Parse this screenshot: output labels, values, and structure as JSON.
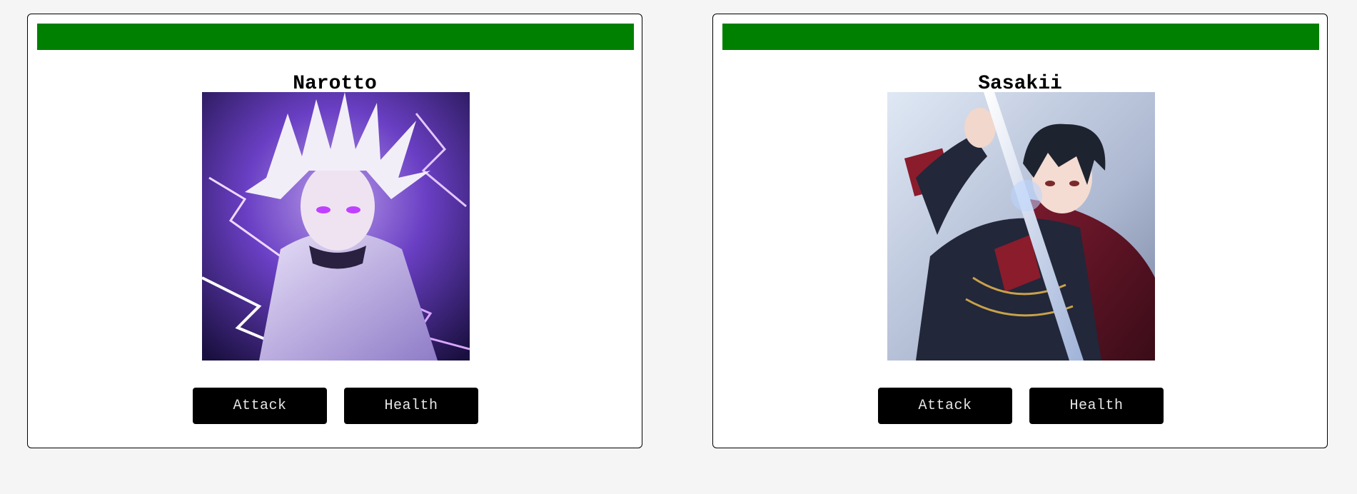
{
  "colors": {
    "health_bar": "#008000",
    "button_bg": "#000000",
    "button_text": "#e6e6e6"
  },
  "cards": [
    {
      "name": "Narotto",
      "health_percent": 100,
      "portrait": "white-haired anime character with purple lightning",
      "buttons": {
        "attack": "Attack",
        "health": "Health"
      }
    },
    {
      "name": "Sasakii",
      "health_percent": 100,
      "portrait": "dark-haired anime swordsman in red cape",
      "buttons": {
        "attack": "Attack",
        "health": "Health"
      }
    }
  ]
}
